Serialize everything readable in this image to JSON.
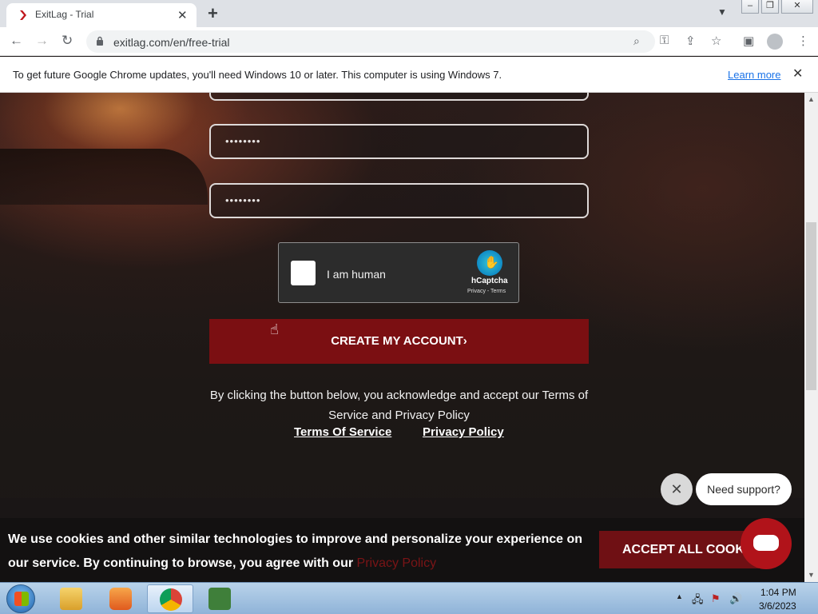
{
  "browser": {
    "tab_title": "ExitLag - Trial",
    "tab_close": "✕",
    "new_tab": "+",
    "url": "exitlag.com/en/free-trial"
  },
  "infobar": {
    "message": "To get future Google Chrome updates, you'll need Windows 10 or later. This computer is using Windows 7.",
    "link": "Learn more",
    "close": "✕"
  },
  "form": {
    "password_mask": "••••••••",
    "confirm_mask": "••••••••",
    "captcha_label": "I am human",
    "captcha_brand": "hCaptcha",
    "captcha_links": "Privacy - Terms",
    "submit_label": "CREATE MY ACCOUNT›",
    "acknowledge": "By clicking the button below, you acknowledge and accept our Terms of Service and Privacy Policy",
    "terms_link": "Terms Of Service",
    "privacy_link": "Privacy Policy"
  },
  "support": {
    "close": "✕",
    "bubble": "Need support?"
  },
  "cookie": {
    "text": "We use cookies and other similar technologies to improve and personalize your experience on our service. By continuing to browse, you agree with our",
    "link": "Privacy Policy",
    "accept": "ACCEPT ALL COOKIES"
  },
  "taskbar": {
    "time": "1:04 PM",
    "date": "3/6/2023",
    "apps": [
      "explorer",
      "media-player",
      "chrome",
      "csharp"
    ]
  },
  "colors": {
    "brand_red": "#7b0f12",
    "chat_red": "#b1131a",
    "link_blue": "#1a73e8"
  }
}
